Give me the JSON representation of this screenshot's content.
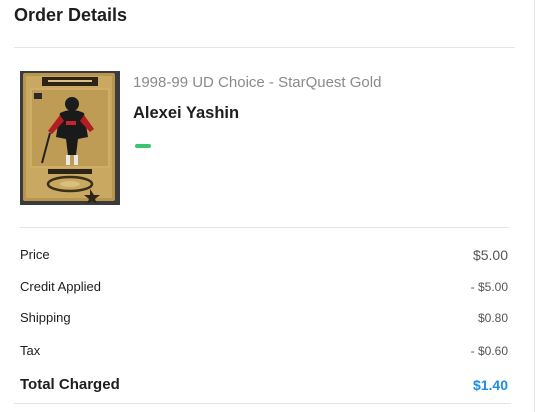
{
  "header": {
    "title": "Order Details"
  },
  "product": {
    "image_icon": "trading-card-image",
    "set_name": "1998-99 UD Choice - StarQuest Gold",
    "player_name": "Alexei Yashin",
    "condition_color": "#3cc46f"
  },
  "summary": {
    "price_label": "Price",
    "price_value": "$5.00",
    "credit_label": "Credit Applied",
    "credit_value": "- $5.00",
    "shipping_label": "Shipping",
    "shipping_value": "$0.80",
    "tax_label": "Tax",
    "tax_value": "- $0.60",
    "total_label": "Total Charged",
    "total_value": "$1.40",
    "total_color": "#1c8de8"
  }
}
